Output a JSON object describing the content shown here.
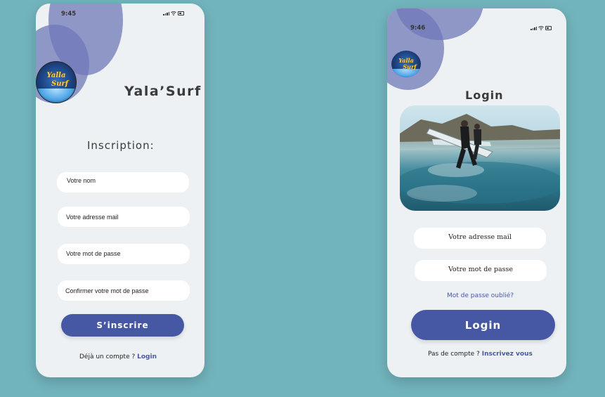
{
  "signup_screen": {
    "status_time": "9:45",
    "logo_text_top": "Yalla",
    "logo_text_bottom": "Surf",
    "app_name": "Yala’Surf",
    "heading": "Inscription:",
    "fields": {
      "name": "Votre nom",
      "email": "Votre adresse mail",
      "password": "Votre mot de passe",
      "confirm_password": "Confirmer votre mot de passe"
    },
    "submit_label": "S’inscrire",
    "footer_prompt": "Déjà un compte ?",
    "footer_link": "Login"
  },
  "login_screen": {
    "status_time": "9:46",
    "logo_text_top": "Yalla",
    "logo_text_bottom": "Surf",
    "heading": "Login",
    "fields": {
      "email": "Votre adresse mail",
      "password": "Votre mot de passe"
    },
    "forgot_password": "Mot de passe oublié?",
    "submit_label": "Login",
    "footer_prompt": "Pas de compte ?",
    "footer_link": "Inscrivez vous"
  },
  "colors": {
    "background": "#72b4bd",
    "card": "#eef1f3",
    "accent": "#4658a4",
    "circles": "#6f78b8"
  },
  "icons": [
    "signal-icon",
    "wifi-icon",
    "battery-icon"
  ]
}
